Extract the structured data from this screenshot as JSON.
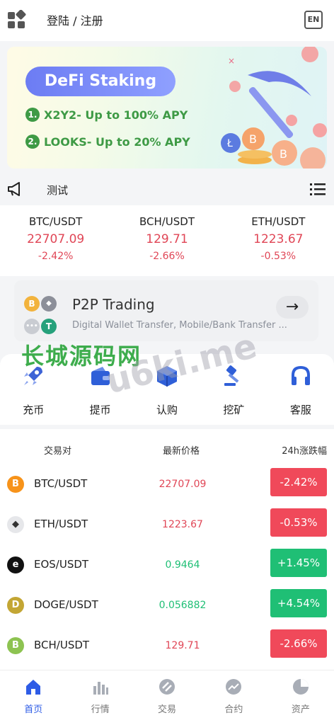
{
  "header": {
    "login_label": "登陆 / 注册",
    "lang": "EN"
  },
  "banner": {
    "title": "DeFi Staking",
    "line1_num": "1.",
    "line1": "X2Y2- Up to 100% APY",
    "line2_num": "2.",
    "line2": "LOOKS- Up to 20% APY"
  },
  "notice": {
    "text": "测试"
  },
  "tickers": [
    {
      "pair": "BTC/USDT",
      "price": "22707.09",
      "change": "-2.42%"
    },
    {
      "pair": "BCH/USDT",
      "price": "129.71",
      "change": "-2.66%"
    },
    {
      "pair": "ETH/USDT",
      "price": "1223.67",
      "change": "-0.53%"
    }
  ],
  "p2p": {
    "title": "P2P Trading",
    "subtitle": "Digital Wallet Transfer, Mobile/Bank Transfer ...",
    "coins": [
      "B",
      "◆",
      "•••",
      "T"
    ]
  },
  "watermark": {
    "text": "长城源码网",
    "overlay": "u6ki.me"
  },
  "quick_actions": [
    {
      "label": "充币",
      "icon": "rocket-icon"
    },
    {
      "label": "提币",
      "icon": "wallet-icon"
    },
    {
      "label": "认购",
      "icon": "box-icon"
    },
    {
      "label": "挖矿",
      "icon": "hammer-icon"
    },
    {
      "label": "客服",
      "icon": "headset-icon"
    }
  ],
  "market": {
    "headers": {
      "pair": "交易对",
      "price": "最新价格",
      "change": "24h涨跌幅"
    },
    "rows": [
      {
        "symbol": "B",
        "pair": "BTC/USDT",
        "price": "22707.09",
        "change": "-2.42%",
        "trend": "down",
        "color": "#f7931a"
      },
      {
        "symbol": "◆",
        "pair": "ETH/USDT",
        "price": "1223.67",
        "change": "-0.53%",
        "trend": "down",
        "color": "#e6e7ea"
      },
      {
        "symbol": "e",
        "pair": "EOS/USDT",
        "price": "0.9464",
        "change": "+1.45%",
        "trend": "up",
        "color": "#111111"
      },
      {
        "symbol": "D",
        "pair": "DOGE/USDT",
        "price": "0.056882",
        "change": "+4.54%",
        "trend": "up",
        "color": "#c3a634"
      },
      {
        "symbol": "B",
        "pair": "BCH/USDT",
        "price": "129.71",
        "change": "-2.66%",
        "trend": "down",
        "color": "#8dc351"
      }
    ]
  },
  "tabbar": [
    {
      "label": "首页",
      "icon": "home-icon",
      "active": true
    },
    {
      "label": "行情",
      "icon": "bar-chart-icon",
      "active": false
    },
    {
      "label": "交易",
      "icon": "exchange-icon",
      "active": false
    },
    {
      "label": "合约",
      "icon": "trend-icon",
      "active": false
    },
    {
      "label": "资产",
      "icon": "pie-chart-icon",
      "active": false
    }
  ],
  "colors": {
    "down": "#f0495a",
    "up": "#1fbf75",
    "accent": "#2e5ce6"
  }
}
